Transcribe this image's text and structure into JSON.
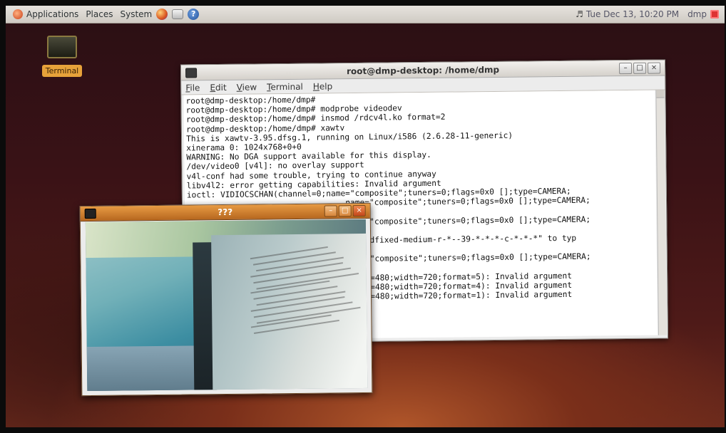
{
  "top_panel": {
    "menus": [
      "Applications",
      "Places",
      "System"
    ],
    "clock": "Tue Dec 13, 10:20 PM",
    "user": "dmp"
  },
  "desktop": {
    "icons": [
      {
        "label": "Terminal",
        "icon": "terminal-icon"
      }
    ]
  },
  "terminal_window": {
    "title": "root@dmp-desktop: /home/dmp",
    "menu": [
      "File",
      "Edit",
      "View",
      "Terminal",
      "Help"
    ],
    "lines": [
      "root@dmp-desktop:/home/dmp#",
      "root@dmp-desktop:/home/dmp# modprobe videodev",
      "root@dmp-desktop:/home/dmp# insmod /rdcv4l.ko format=2",
      "root@dmp-desktop:/home/dmp# xawtv",
      "This is xawtv-3.95.dfsg.1, running on Linux/i586 (2.6.28-11-generic)",
      "xinerama 0: 1024x768+0+0",
      "WARNING: No DGA support available for this display.",
      "/dev/video0 [v4l]: no overlay support",
      "v4l-conf had some trouble, trying to continue anyway",
      "libv4l2: error getting capabilities: Invalid argument",
      "ioctl: VIDIOCSCHAN(channel=0;name=\"composite\";tuners=0;flags=0x0 [];type=CAMERA;",
      "                                 name=\"composite\";tuners=0;flags=0x0 [];type=CAMERA;",
      "",
      "                                 name=\"composite\";tuners=0;flags=0x0 [];type=CAMERA;",
      "",
      "                                 -*-ledfixed-medium-r-*--39-*-*-*-c-*-*-*\" to typ",
      "",
      "                                 name=\"composite\";tuners=0;flags=0x0 [];type=CAMERA;",
      "",
      "                                 eight=480;width=720;format=5): Invalid argument",
      "                                 eight=480;width=720;format=4): Invalid argument",
      "                                 eight=480;width=720;format=1): Invalid argument"
    ]
  },
  "xawtv_window": {
    "title": "???"
  },
  "colors": {
    "panel": "#dcd8d2",
    "desktop_accent": "#b0562a",
    "xawtv_titlebar": "#d68236",
    "desktop_label": "#e7a23a"
  }
}
